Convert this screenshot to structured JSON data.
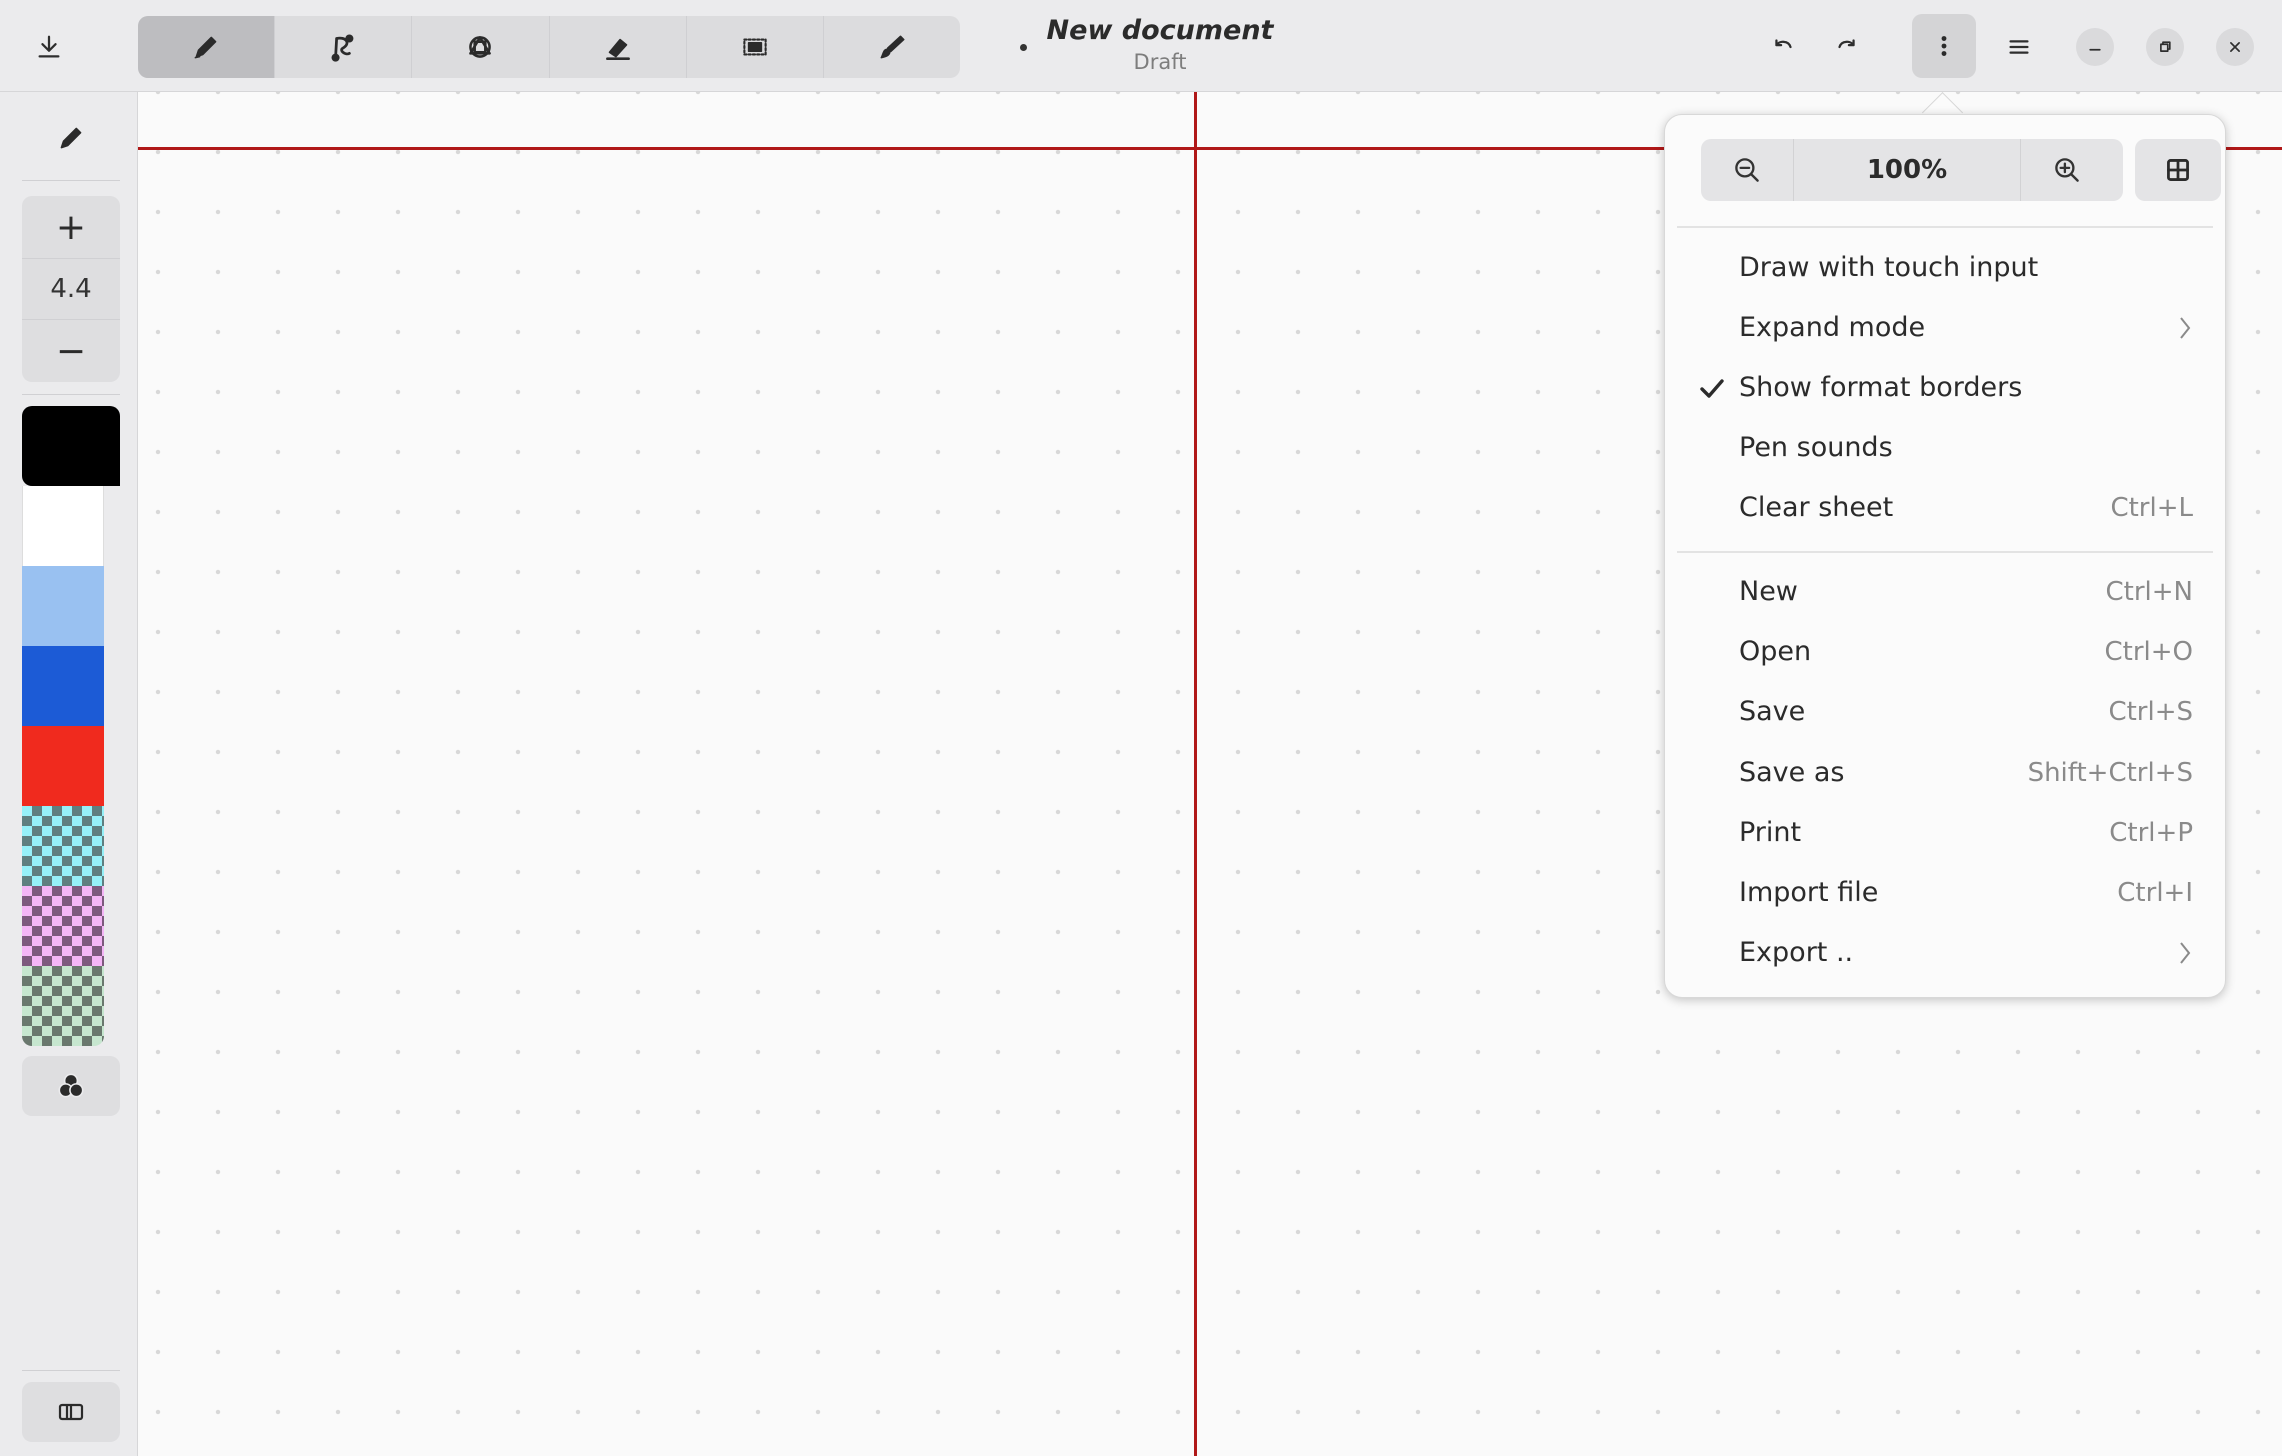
{
  "header": {
    "title": "New document",
    "subtitle": "Draft",
    "tools": [
      {
        "name": "pen",
        "icon": "pencil-icon",
        "active": true
      },
      {
        "name": "shaper",
        "icon": "shaper-icon",
        "active": false
      },
      {
        "name": "typewriter",
        "icon": "shapes-icon",
        "active": false
      },
      {
        "name": "eraser",
        "icon": "eraser-icon",
        "active": false
      },
      {
        "name": "selector",
        "icon": "selector-icon",
        "active": false
      },
      {
        "name": "tools",
        "icon": "brush-icon",
        "active": false
      }
    ]
  },
  "sidebar": {
    "stroke_width": "4.4",
    "colors": [
      "#000000",
      "#ffffff",
      "#99c1f1",
      "#1c5bd6",
      "#f02a1e",
      "checker-cyan",
      "checker-pink",
      "checker-green"
    ]
  },
  "popover": {
    "zoom_value": "100%",
    "section1": [
      {
        "label": "Draw with touch input",
        "accel": "",
        "submenu": false,
        "checked": false
      },
      {
        "label": "Expand mode",
        "accel": "",
        "submenu": true,
        "checked": false
      },
      {
        "label": "Show format borders",
        "accel": "",
        "submenu": false,
        "checked": true
      },
      {
        "label": "Pen sounds",
        "accel": "",
        "submenu": false,
        "checked": false
      },
      {
        "label": "Clear sheet",
        "accel": "Ctrl+L",
        "submenu": false,
        "checked": false
      }
    ],
    "section2": [
      {
        "label": "New",
        "accel": "Ctrl+N",
        "submenu": false
      },
      {
        "label": "Open",
        "accel": "Ctrl+O",
        "submenu": false
      },
      {
        "label": "Save",
        "accel": "Ctrl+S",
        "submenu": false
      },
      {
        "label": "Save as",
        "accel": "Shift+Ctrl+S",
        "submenu": false
      },
      {
        "label": "Print",
        "accel": "Ctrl+P",
        "submenu": false
      },
      {
        "label": "Import file",
        "accel": "Ctrl+I",
        "submenu": false
      },
      {
        "label": "Export ..",
        "accel": "",
        "submenu": true
      }
    ]
  }
}
